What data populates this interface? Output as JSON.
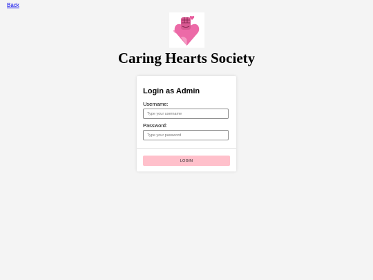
{
  "nav": {
    "back_label": "Back"
  },
  "brand": {
    "name": "Caring Hearts Society",
    "logo_icon": "heart-fist-logo-icon"
  },
  "login_form": {
    "title": "Login as Admin",
    "username_label": "Username:",
    "username_placeholder": "Type your username",
    "username_value": "",
    "password_label": "Password:",
    "password_placeholder": "Type your password",
    "password_value": "",
    "submit_label": "LOGIN"
  },
  "colors": {
    "page_background": "#f4f4f4",
    "card_background": "#ffffff",
    "button_background": "#ffc0cb",
    "logo_pink": "#e8579a",
    "link": "#0000ee"
  }
}
